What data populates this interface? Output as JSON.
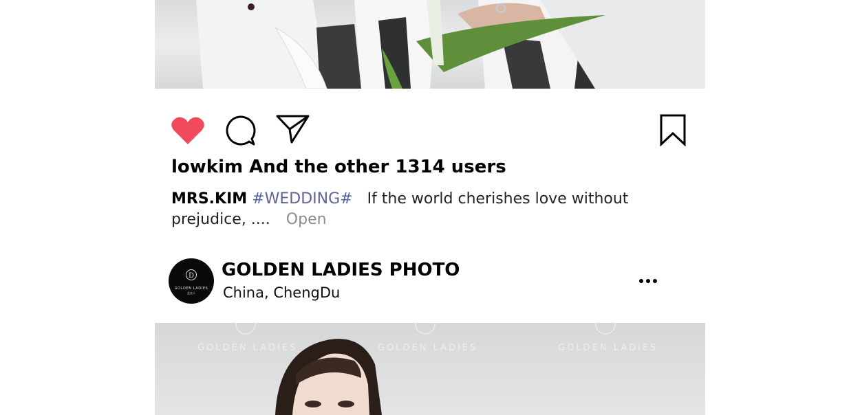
{
  "post_actions": {
    "like_icon": "heart-icon",
    "comment_icon": "comment-icon",
    "share_icon": "send-icon",
    "save_icon": "bookmark-icon",
    "like_color": "#f04a5c"
  },
  "likes_text": "lowkim And the other 1314 users",
  "caption": {
    "username": "MRS.KIM",
    "hashtag": "#WEDDING#",
    "text": "If the world cherishes love without prejudice, ....",
    "more_label": "Open",
    "hashtag_color": "#5d6497"
  },
  "next_post": {
    "account_name": "GOLDEN LADIES PHOTO",
    "location": "China,  ChengDu",
    "avatar_logo_text": "GOLDEN LADIES",
    "avatar_logo_subtext": "金夫人",
    "more_icon": "more-horizontal-icon"
  },
  "watermarks": [
    "GOLDEN LADIES",
    "GOLDEN LADIES",
    "GOLDEN LADIES"
  ]
}
